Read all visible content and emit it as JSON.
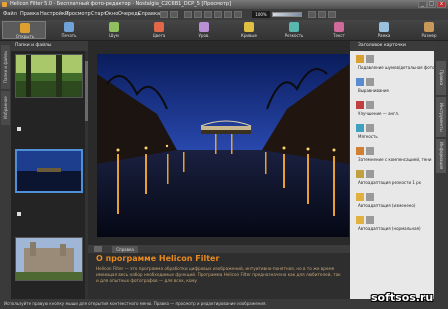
{
  "window": {
    "title": "Helicon Filter 5.0 · Бесплатный фото-редактор · Nostalgia_C2C6B1_DCP_5 [Просмотр]",
    "minimize": "_",
    "maximize": "□",
    "close": "x"
  },
  "menu": [
    "Файл",
    "Правка",
    "Настройки",
    "Просмотр",
    "Старт",
    "Окно",
    "Очередь",
    "Справка"
  ],
  "zoom": {
    "value": "100%",
    "level": 0.5
  },
  "toolbar": [
    {
      "label": "Открыть",
      "color": "#e0a030"
    },
    {
      "label": "Печать",
      "color": "#6fa3d8"
    },
    {
      "label": "Шум",
      "color": "#8fbf5f"
    },
    {
      "label": "Цвета",
      "color": "#e06848"
    },
    {
      "label": "Уров.",
      "color": "#b98fd6"
    },
    {
      "label": "Кривые",
      "color": "#e0c040"
    },
    {
      "label": "Резкость",
      "color": "#58b8b0"
    },
    {
      "label": "Текст",
      "color": "#d06a9a"
    },
    {
      "label": "Рамка",
      "color": "#9ac0e0"
    },
    {
      "label": "Размер",
      "color": "#c89858"
    }
  ],
  "left_tabs": [
    "Папки и файлы",
    "Избранное"
  ],
  "files": {
    "header": "Папки и файлы",
    "items": [
      {
        "name": "",
        "selected": false
      },
      {
        "name": "",
        "selected": false
      },
      {
        "name": "",
        "selected": true
      },
      {
        "name": "",
        "selected": false
      }
    ]
  },
  "viewer_tabs": {
    "active": "Справка"
  },
  "description": {
    "title": "О программе Helicon Filter",
    "text": "Helicon Filter — это программа обработки цифровых изображений, интуитивно-понятная, но в то же время имеющая весь набор необходимых функций. Программа Helicon Filter предназначена как для любителей, так и для опытных фотографов — для всех, кому"
  },
  "right_panel": {
    "header": "Заголовок карточки",
    "items": [
      "Подавление шумов/детальная фото сод.",
      "Выравнивание",
      "Улучшение — англ.",
      "Мягкость",
      "Затемнение с компенсацией, тени",
      "Автоадаптация резкости 1 px",
      "Автоадаптация (изменено)",
      "Автоадаптация (нормальная)"
    ]
  },
  "right_tabs": [
    "Правка",
    "Инструменты",
    "Информация"
  ],
  "status": "Используйте правую кнопку мыши для открытия контекстного меню. Правка — просмотр и редактирование изображения.",
  "watermark": "softsos.ru"
}
